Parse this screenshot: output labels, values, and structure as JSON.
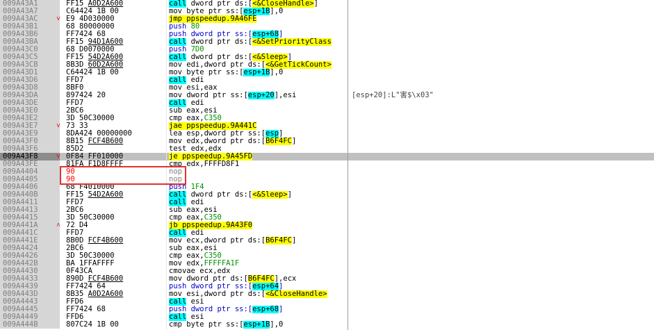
{
  "rows": [
    {
      "addr": "009A43A1",
      "arrow": "",
      "bytes": "FF15 A0D2A600",
      "ubytes": true,
      "dis": [
        [
          "c-hl-call",
          "call"
        ],
        [
          "",
          " dword ptr ds:["
        ],
        [
          "c-ptr",
          "<&CloseHandle>"
        ],
        [
          "",
          "]"
        ]
      ],
      "comment": ""
    },
    {
      "addr": "009A43A7",
      "arrow": "",
      "bytes": "C64424 1B 00",
      "dis": [
        [
          "",
          "mov byte ptr ss:["
        ],
        [
          "c-reg-hl",
          "esp+1B"
        ],
        [
          "",
          "],0"
        ]
      ],
      "comment": ""
    },
    {
      "addr": "009A43AC",
      "arrow": "v",
      "bytes": "E9 4D030000",
      "dis": [
        [
          "c-hl-jmp",
          "jmp ppspeedup.9A46FE"
        ]
      ],
      "comment": ""
    },
    {
      "addr": "009A43B1",
      "arrow": "",
      "bytes": "68 80000000",
      "dis": [
        [
          "c-blue",
          "push "
        ],
        [
          "c-green",
          "80"
        ]
      ],
      "comment": ""
    },
    {
      "addr": "009A43B6",
      "arrow": "",
      "bytes": "FF7424 68",
      "dis": [
        [
          "c-blue",
          "push dword ptr ss:["
        ],
        [
          "c-reg-hl",
          "esp+68"
        ],
        [
          "c-blue",
          "]"
        ]
      ],
      "comment": ""
    },
    {
      "addr": "009A43BA",
      "arrow": "",
      "bytes": "FF15 94D1A600",
      "ubytes": true,
      "dis": [
        [
          "c-hl-call",
          "call"
        ],
        [
          "",
          " dword ptr ds:["
        ],
        [
          "c-ptr",
          "<&SetPriorityClass"
        ]
      ],
      "comment": ""
    },
    {
      "addr": "009A43C0",
      "arrow": "",
      "bytes": "68 D0070000",
      "dis": [
        [
          "c-blue",
          "push "
        ],
        [
          "c-green",
          "7D0"
        ]
      ],
      "comment": ""
    },
    {
      "addr": "009A43C5",
      "arrow": "",
      "bytes": "FF15 54D2A600",
      "ubytes": true,
      "dis": [
        [
          "c-hl-call",
          "call"
        ],
        [
          "",
          " dword ptr ds:["
        ],
        [
          "c-ptr",
          "<&Sleep>"
        ],
        [
          "",
          "]"
        ]
      ],
      "comment": ""
    },
    {
      "addr": "009A43CB",
      "arrow": "",
      "bytes": "8B3D 60D2A600",
      "ubytes": true,
      "dis": [
        [
          "",
          "mov edi,dword ptr ds:["
        ],
        [
          "c-ptr",
          "<&GetTickCount>"
        ]
      ],
      "comment": ""
    },
    {
      "addr": "009A43D1",
      "arrow": "",
      "bytes": "C64424 1B 00",
      "dis": [
        [
          "",
          "mov byte ptr ss:["
        ],
        [
          "c-reg-hl",
          "esp+1B"
        ],
        [
          "",
          "],0"
        ]
      ],
      "comment": ""
    },
    {
      "addr": "009A43D6",
      "arrow": "",
      "bytes": "FFD7",
      "dis": [
        [
          "c-hl-call",
          "call"
        ],
        [
          "",
          " edi"
        ]
      ],
      "comment": ""
    },
    {
      "addr": "009A43D8",
      "arrow": "",
      "bytes": "8BF0",
      "dis": [
        [
          "",
          "mov esi,eax"
        ]
      ],
      "comment": ""
    },
    {
      "addr": "009A43DA",
      "arrow": "",
      "bytes": "897424 20",
      "dis": [
        [
          "",
          "mov dword ptr ss:["
        ],
        [
          "c-reg-hl",
          "esp+20"
        ],
        [
          "",
          "],esi"
        ]
      ],
      "comment": "[esp+20]:L\"害$\\x03\""
    },
    {
      "addr": "009A43DE",
      "arrow": "",
      "bytes": "FFD7",
      "dis": [
        [
          "c-hl-call",
          "call"
        ],
        [
          "",
          " edi"
        ]
      ],
      "comment": ""
    },
    {
      "addr": "009A43E0",
      "arrow": "",
      "bytes": "2BC6",
      "dis": [
        [
          "",
          "sub eax,esi"
        ]
      ],
      "comment": ""
    },
    {
      "addr": "009A43E2",
      "arrow": "",
      "bytes": "3D 50C30000",
      "dis": [
        [
          "",
          "cmp eax,"
        ],
        [
          "c-green",
          "C350"
        ]
      ],
      "comment": ""
    },
    {
      "addr": "009A43E7",
      "arrow": "v",
      "bytes": "73 33",
      "dis": [
        [
          "c-hl-jmp",
          "jae ppspeedup.9A441C"
        ]
      ],
      "comment": ""
    },
    {
      "addr": "009A43E9",
      "arrow": "",
      "bytes": "8DA424 00000000",
      "dis": [
        [
          "",
          "lea esp,dword ptr ss:["
        ],
        [
          "c-reg-hl",
          "esp"
        ],
        [
          "",
          "]"
        ]
      ],
      "comment": ""
    },
    {
      "addr": "009A43F0",
      "arrow": "",
      "bytes": "8B15 FCF4B600",
      "ubytes": true,
      "dis": [
        [
          "",
          "mov edx,dword ptr ds:["
        ],
        [
          "c-ptr",
          "B6F4FC"
        ],
        [
          "",
          "]"
        ]
      ],
      "comment": ""
    },
    {
      "addr": "009A43F6",
      "arrow": "",
      "bytes": "85D2",
      "dis": [
        [
          "",
          "test edx,edx"
        ]
      ],
      "comment": ""
    },
    {
      "addr": "009A43F8",
      "arrow": "v",
      "bytes": "0F84 FF010000",
      "sel": true,
      "dis": [
        [
          "c-hl-jmp",
          "je ppspeedup.9A45FD"
        ]
      ],
      "comment": ""
    },
    {
      "addr": "009A43FE",
      "arrow": "",
      "bytes": "81FA F1D8FFFF",
      "dis": [
        [
          "",
          "cmp edx,FFFFD8F1"
        ]
      ],
      "comment": ""
    },
    {
      "addr": "009A4404",
      "arrow": "",
      "bytes": "90",
      "red": true,
      "dis": [
        [
          "c-gray",
          "nop"
        ]
      ],
      "comment": ""
    },
    {
      "addr": "009A4405",
      "arrow": "",
      "bytes": "90",
      "red": true,
      "dis": [
        [
          "c-gray",
          "nop"
        ]
      ],
      "comment": ""
    },
    {
      "addr": "009A4406",
      "arrow": "",
      "bytes": "68 F4010000",
      "dis": [
        [
          "c-blue",
          "push "
        ],
        [
          "c-green",
          "1F4"
        ]
      ],
      "comment": ""
    },
    {
      "addr": "009A440B",
      "arrow": "",
      "bytes": "FF15 54D2A600",
      "ubytes": true,
      "dis": [
        [
          "c-hl-call",
          "call"
        ],
        [
          "",
          " dword ptr ds:["
        ],
        [
          "c-ptr",
          "<&Sleep>"
        ],
        [
          "",
          "]"
        ]
      ],
      "comment": ""
    },
    {
      "addr": "009A4411",
      "arrow": "",
      "bytes": "FFD7",
      "dis": [
        [
          "c-hl-call",
          "call"
        ],
        [
          "",
          " edi"
        ]
      ],
      "comment": ""
    },
    {
      "addr": "009A4413",
      "arrow": "",
      "bytes": "2BC6",
      "dis": [
        [
          "",
          "sub eax,esi"
        ]
      ],
      "comment": ""
    },
    {
      "addr": "009A4415",
      "arrow": "",
      "bytes": "3D 50C30000",
      "dis": [
        [
          "",
          "cmp eax,"
        ],
        [
          "c-green",
          "C350"
        ]
      ],
      "comment": ""
    },
    {
      "addr": "009A441A",
      "arrow": "^",
      "bytes": "72 D4",
      "dis": [
        [
          "c-hl-jmp",
          "jb ppspeedup.9A43F0"
        ]
      ],
      "comment": ""
    },
    {
      "addr": "009A441C",
      "arrow": "",
      "bytes": "FFD7",
      "dis": [
        [
          "c-hl-call",
          "call"
        ],
        [
          "",
          " edi"
        ]
      ],
      "comment": ""
    },
    {
      "addr": "009A441E",
      "arrow": "",
      "bytes": "8B0D FCF4B600",
      "ubytes": true,
      "dis": [
        [
          "",
          "mov ecx,dword ptr ds:["
        ],
        [
          "c-ptr",
          "B6F4FC"
        ],
        [
          "",
          "]"
        ]
      ],
      "comment": ""
    },
    {
      "addr": "009A4424",
      "arrow": "",
      "bytes": "2BC6",
      "dis": [
        [
          "",
          "sub eax,esi"
        ]
      ],
      "comment": ""
    },
    {
      "addr": "009A4426",
      "arrow": "",
      "bytes": "3D 50C30000",
      "dis": [
        [
          "",
          "cmp eax,"
        ],
        [
          "c-green",
          "C350"
        ]
      ],
      "comment": ""
    },
    {
      "addr": "009A442B",
      "arrow": "",
      "bytes": "BA 1FFAFFFF",
      "dis": [
        [
          "",
          "mov edx,"
        ],
        [
          "c-green",
          "FFFFFA1F"
        ]
      ],
      "comment": ""
    },
    {
      "addr": "009A4430",
      "arrow": "",
      "bytes": "0F43CA",
      "dis": [
        [
          "",
          "cmovae ecx,edx"
        ]
      ],
      "comment": ""
    },
    {
      "addr": "009A4433",
      "arrow": "",
      "bytes": "890D FCF4B600",
      "ubytes": true,
      "dis": [
        [
          "",
          "mov dword ptr ds:["
        ],
        [
          "c-ptr",
          "B6F4FC"
        ],
        [
          "",
          "],ecx"
        ]
      ],
      "comment": ""
    },
    {
      "addr": "009A4439",
      "arrow": "",
      "bytes": "FF7424 64",
      "dis": [
        [
          "c-blue",
          "push dword ptr ss:["
        ],
        [
          "c-reg-hl",
          "esp+64"
        ],
        [
          "c-blue",
          "]"
        ]
      ],
      "comment": ""
    },
    {
      "addr": "009A443D",
      "arrow": "",
      "bytes": "8B35 A0D2A600",
      "ubytes": true,
      "dis": [
        [
          "",
          "mov esi,dword ptr ds:["
        ],
        [
          "c-ptr",
          "<&CloseHandle>"
        ]
      ],
      "comment": ""
    },
    {
      "addr": "009A4443",
      "arrow": "",
      "bytes": "FFD6",
      "dis": [
        [
          "c-hl-call",
          "call"
        ],
        [
          "",
          " esi"
        ]
      ],
      "comment": ""
    },
    {
      "addr": "009A4445",
      "arrow": "",
      "bytes": "FF7424 68",
      "dis": [
        [
          "c-blue",
          "push dword ptr ss:["
        ],
        [
          "c-reg-hl",
          "esp+68"
        ],
        [
          "c-blue",
          "]"
        ]
      ],
      "comment": ""
    },
    {
      "addr": "009A4449",
      "arrow": "",
      "bytes": "FFD6",
      "dis": [
        [
          "c-hl-call",
          "call"
        ],
        [
          "",
          " esi"
        ]
      ],
      "comment": ""
    },
    {
      "addr": "009A444B",
      "arrow": "",
      "bytes": "807C24 1B 00",
      "dis": [
        [
          "",
          "cmp byte ptr ss:["
        ],
        [
          "c-reg-hl",
          "esp+1B"
        ],
        [
          "",
          "],0"
        ]
      ],
      "comment": ""
    }
  ],
  "colors": {
    "accent_call": "#00ffff",
    "accent_jmp": "#ffff00",
    "selection": "#c0c0c0",
    "annotation_box": "#e03030"
  }
}
